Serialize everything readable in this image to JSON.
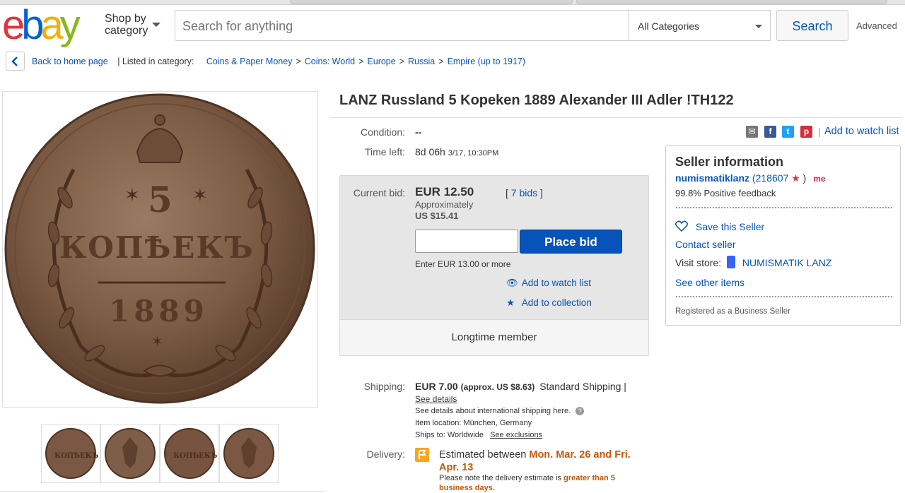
{
  "header": {
    "logo_letters": [
      "e",
      "b",
      "a",
      "y"
    ],
    "logo_colors": [
      "#e53238",
      "#0064d2",
      "#f5af02",
      "#86b817"
    ],
    "shop_by_line1": "Shop by",
    "shop_by_line2": "category",
    "search_placeholder": "Search for anything",
    "category_selected": "All Categories",
    "search_button": "Search",
    "advanced_link": "Advanced"
  },
  "breadcrumb": {
    "back_label": "Back to home page",
    "listed_in": "| Listed in category:",
    "items": [
      "Coins & Paper Money",
      "Coins: World",
      "Europe",
      "Russia",
      "Empire (up to 1917)"
    ],
    "separator": ">"
  },
  "listing": {
    "title": "LANZ Russland 5 Kopeken 1889 Alexander III Adler !TH122",
    "condition_label": "Condition:",
    "condition_value": "--",
    "time_left_label": "Time left:",
    "time_left_value": "8d 06h",
    "time_left_date": "3/17, 10:30PM",
    "watch_list_top": "Add to watch list",
    "share_icons": [
      "email-icon",
      "facebook-icon",
      "twitter-icon",
      "pinterest-icon"
    ]
  },
  "bid": {
    "current_bid_label": "Current bid:",
    "current_bid_value": "EUR 12.50",
    "approx_label": "Approximately",
    "approx_value": "US $15.41",
    "bids_count": "7 bids",
    "place_bid_button": "Place bid",
    "enter_hint": "Enter EUR 13.00 or more",
    "add_watch": "Add to watch list",
    "add_collection": "Add to collection",
    "member_label": "Longtime member"
  },
  "shipping": {
    "label": "Shipping:",
    "price": "EUR 7.00",
    "approx": "(approx. US $8.63)",
    "service": "Standard Shipping |",
    "see_details": "See details",
    "intl_note": "See details about international shipping here.",
    "location": "Item location:  München, Germany",
    "ships_to": "Ships to:  Worldwide",
    "see_exclusions": "See exclusions"
  },
  "delivery": {
    "label": "Delivery:",
    "estimated_prefix": "Estimated between",
    "estimated_dates_1": "Mon. Mar. 26 and Fri.",
    "estimated_dates_2": "Apr. 13",
    "note_prefix": "Please note the delivery estimate is",
    "note_highlight_1": "greater than 5",
    "note_highlight_2": "business days."
  },
  "seller": {
    "heading": "Seller information",
    "name": "numismatiklanz",
    "feedback_open": "(218607",
    "feedback_close": ")",
    "positive_feedback": "99.8% Positive feedback",
    "save_seller": "Save this Seller",
    "contact_seller": "Contact seller",
    "visit_store_label": "Visit store:",
    "store_name": "NUMISMATIK LANZ",
    "see_other": "See other items",
    "business_seller": "Registered as a Business Seller",
    "me_badge": "me"
  },
  "colors": {
    "link_blue": "#0654ba",
    "accent_orange": "#c4560b",
    "panel_gray": "#e6e6e6"
  }
}
